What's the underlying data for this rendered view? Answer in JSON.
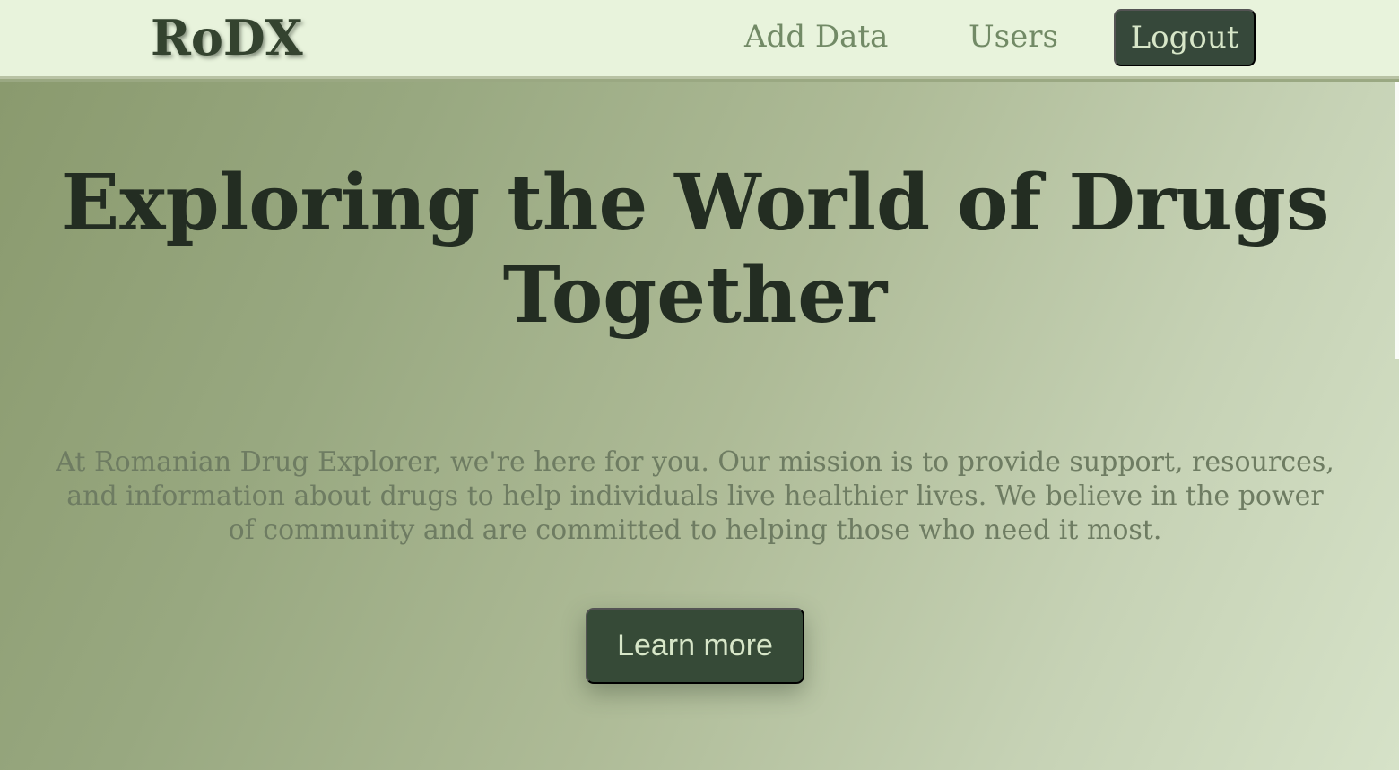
{
  "nav": {
    "logo": "RoDX",
    "links": [
      {
        "label": "Add Data"
      },
      {
        "label": "Users"
      }
    ],
    "logout_label": "Logout"
  },
  "hero": {
    "title": "Exploring the World of Drugs Together",
    "description": "At Romanian Drug Explorer, we're here for you. Our mission is to provide support, resources, and information about drugs to help individuals live healthier lives. We believe in the power of community and are committed to helping those who need it most.",
    "cta_label": "Learn more"
  },
  "colors": {
    "nav_background": "#e8f3dc",
    "button_background": "#364a37",
    "title_text": "#232d22",
    "body_text": "#6e7c62"
  }
}
